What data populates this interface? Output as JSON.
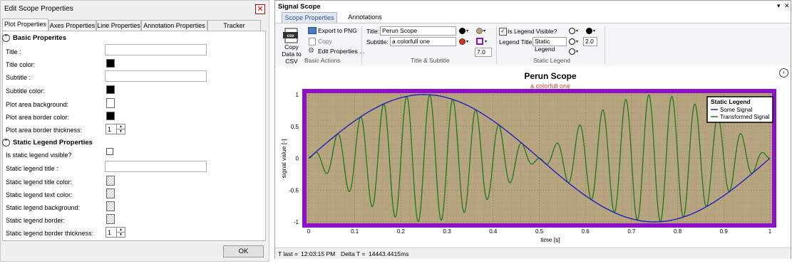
{
  "dialog": {
    "title": "Edit Scope Properties",
    "close_glyph": "✕",
    "tabs": [
      "Plot Properties",
      "Axes Properties",
      "Line Properties",
      "Annotation Properties",
      "Tracker Properties"
    ],
    "sections": {
      "basic": "Basic Properites",
      "legend": "Static Legend Properties"
    },
    "collapse_glyph": "⌃",
    "properties": {
      "title": "Title :",
      "title_color": "Title color:",
      "subtitle": "Subtitle :",
      "subtitle_color": "Subtitle color:",
      "plot_bg": "Plot area background:",
      "plot_border_color": "Plot area border color:",
      "plot_border_thickness": "Plot area border thickness:",
      "legend_visible": "Is static legend visible?",
      "legend_title": "Static legend title :",
      "legend_title_color": "Static legend title color:",
      "legend_text_color": "Static legend text color:",
      "legend_bg": "Static legend background:",
      "legend_border": "Static legend border:",
      "legend_border_thickness": "Static legend border thickness:"
    },
    "values": {
      "plot_border_thickness": "1",
      "legend_border_thickness": "1"
    },
    "ok_label": "OK"
  },
  "scope": {
    "title": "Signal Scope",
    "window_controls": {
      "pin": "▾",
      "close": "✕"
    },
    "tabs": [
      "Scope Properties",
      "Annotations"
    ],
    "ribbon": {
      "copy_csv": "Copy Data to CSV",
      "export_png": "Export to PNG",
      "copy": "Copy",
      "edit_props": "Edit Properties ...",
      "group_actions": "Basic Actions",
      "title_label": "Title:",
      "title_value": "Perun Scope",
      "subtitle_label": "Subtitle:",
      "subtitle_value": "a colorfull one",
      "font_size": "7.0",
      "group_title": "Title & Subtitle",
      "legend_visible_label": "Is Legend Visible?",
      "legend_title_label": "Legend Title:",
      "legend_title_value": "Static Legend",
      "legend_size": "2.0",
      "group_legend": "Static Legend"
    },
    "colors": {
      "title_dot": "#000000",
      "subtitle_dot": "#c0392b",
      "tan": "#b5a27e",
      "purple": "#8b10c8",
      "plot_bg": "#b7a57f",
      "series1": "#2020c0",
      "series2": "#1d7a1d",
      "subtitle_text": "#d04a2a"
    },
    "status": {
      "t_last_label": "T last =",
      "t_last_value": "12:03:15 PM",
      "delta_label": "Delta T =",
      "delta_value": "14443.4415",
      "delta_unit": "ms"
    }
  },
  "chart_data": {
    "type": "line",
    "title": "Perun Scope",
    "subtitle": "a colorfull one",
    "xlabel": "time [s]",
    "ylabel": "signal value [-]",
    "xlim": [
      0,
      1
    ],
    "ylim": [
      -1,
      1
    ],
    "xticks": [
      "0",
      "0.1",
      "0.2",
      "0.3",
      "0.4",
      "0.5",
      "0.6",
      "0.7",
      "0.8",
      "0.9",
      "1"
    ],
    "yticks": [
      "1",
      "0.5",
      "0",
      "-0.5",
      "-1"
    ],
    "grid": true,
    "legend": {
      "title": "Static Legend",
      "placement": "top-right"
    },
    "series": [
      {
        "name": "Some Signal",
        "function": "sin(2*pi*t)",
        "x": [
          0,
          0.125,
          0.25,
          0.375,
          0.5,
          0.625,
          0.75,
          0.875,
          1
        ],
        "values": [
          0,
          0.71,
          1,
          0.71,
          0,
          -0.71,
          -1,
          -0.71,
          0
        ]
      },
      {
        "name": "Transformed Signal",
        "function": "sin(2*pi*t)*sin(2*pi*20*t)",
        "approx_cycles": 20,
        "envelope": "Some Signal"
      }
    ]
  }
}
